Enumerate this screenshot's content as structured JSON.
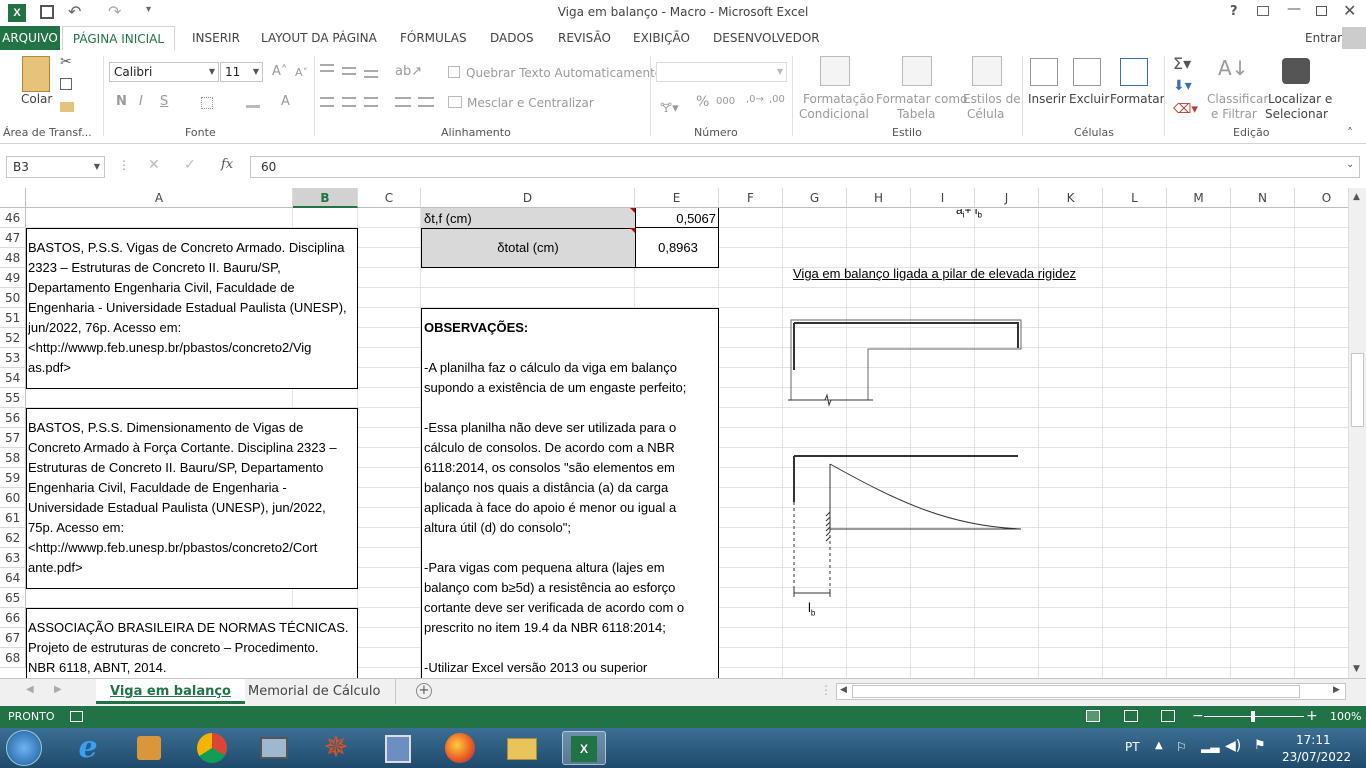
{
  "window": {
    "title": "Viga em balanço - Macro - Microsoft Excel"
  },
  "tabs": {
    "arquivo": "ARQUIVO",
    "pagina_inicial": "PÁGINA INICIAL",
    "inserir": "INSERIR",
    "layout": "LAYOUT DA PÁGINA",
    "formulas": "FÓRMULAS",
    "dados": "DADOS",
    "revisao": "REVISÃO",
    "exibicao": "EXIBIÇÃO",
    "desenvolvedor": "DESENVOLVEDOR",
    "entrar": "Entrar"
  },
  "ribbon": {
    "colar": "Colar",
    "font_name": "Calibri",
    "font_size": "11",
    "quebrar": "Quebrar Texto Automaticamente",
    "mesclar": "Mesclar e Centralizar",
    "formatacao_cond_1": "Formatação",
    "formatacao_cond_2": "Condicional",
    "formatar_tabela_1": "Formatar como",
    "formatar_tabela_2": "Tabela",
    "estilos_celula_1": "Estilos de",
    "estilos_celula_2": "Célula",
    "inserir": "Inserir",
    "excluir": "Excluir",
    "formatar": "Formatar",
    "classificar_1": "Classificar",
    "classificar_2": "e Filtrar",
    "localizar_1": "Localizar e",
    "localizar_2": "Selecionar",
    "groups": {
      "area": "Área de Transf...",
      "fonte": "Fonte",
      "alinhamento": "Alinhamento",
      "numero": "Número",
      "estilo": "Estilo",
      "celulas": "Células",
      "edicao": "Edição"
    },
    "bold": "N",
    "italic": "I",
    "underline": "S"
  },
  "formula_bar": {
    "name_box": "B3",
    "fx": "fx",
    "value": "60"
  },
  "columns": [
    "A",
    "B",
    "C",
    "D",
    "E",
    "F",
    "G",
    "H",
    "I",
    "J",
    "K",
    "L",
    "M",
    "N",
    "O"
  ],
  "rows": [
    "46",
    "47",
    "48",
    "49",
    "50",
    "51",
    "52",
    "53",
    "54",
    "55",
    "56",
    "57",
    "58",
    "59",
    "60",
    "61",
    "62",
    "63",
    "64",
    "65",
    "66",
    "67",
    "68"
  ],
  "cells": {
    "d46": "δt,f (cm)",
    "e46": "0,5067",
    "d47": "δtotal (cm)",
    "e47": "0,8963",
    "ref1": [
      "BASTOS, P.S.S. Vigas de Concreto Armado. Disciplina",
      "2323 – Estruturas de Concreto II. Bauru/SP,",
      "Departamento Engenharia Civil, Faculdade de",
      "Engenharia - Universidade Estadual Paulista (UNESP),",
      "jun/2022, 76p. Acesso em:",
      "<http://wwwp.feb.unesp.br/pbastos/concreto2/Vig",
      "as.pdf>"
    ],
    "ref2": [
      "BASTOS, P.S.S. Dimensionamento de Vigas de",
      "Concreto Armado à Força Cortante. Disciplina 2323 –",
      "Estruturas de Concreto II. Bauru/SP, Departamento",
      "Engenharia Civil, Faculdade de Engenharia -",
      "Universidade Estadual Paulista (UNESP), jun/2022,",
      "75p. Acesso em:",
      "<http://wwwp.feb.unesp.br/pbastos/concreto2/Cort",
      "ante.pdf>"
    ],
    "ref3": [
      "ASSOCIAÇÃO BRASILEIRA DE NORMAS TÉCNICAS.",
      "Projeto de estruturas de concreto – Procedimento.",
      "NBR 6118, ABNT, 2014."
    ],
    "obs_title": "OBSERVAÇÕES:",
    "obs": [
      "",
      "-A planilha faz o cálculo da viga em balanço",
      "supondo a existência de um engaste perfeito;",
      "",
      "-Essa planilha não deve ser utilizada para o",
      "cálculo de consolos. De acordo com a NBR",
      "6118:2014, os consolos \"são elementos em",
      "balanço nos quais a distância (a) da carga",
      "aplicada à face do apoio é menor ou igual a",
      "altura útil (d) do consolo\";",
      "",
      "-Para vigas com pequena altura (lajes em",
      "balanço com b≥5d) a resistência ao esforço",
      "cortante deve ser verificada de acordo com o",
      "prescrito no item 19.4 da NBR 6118:2014;",
      "",
      "-Utilizar Excel versão 2013 ou superior"
    ],
    "figure_caption": "Viga em balanço ligada a pilar de elevada rigidez",
    "top_label": "a",
    "top_label_sub": "i",
    "top_label_plus": "+ l",
    "top_label_sub2": "b",
    "lb_label": "l",
    "lb_sub": "b"
  },
  "sheet_tabs": {
    "active": "Viga em balanço",
    "other": "Memorial de Cálculo"
  },
  "status": {
    "ready": "PRONTO",
    "zoom": "100%"
  },
  "taskbar": {
    "lang": "PT",
    "time": "17:11",
    "date": "23/07/2022"
  },
  "colors": {
    "excel_green": "#217346",
    "selected_col": "#d2d2d2",
    "gray_cell": "#d9d9d9"
  }
}
